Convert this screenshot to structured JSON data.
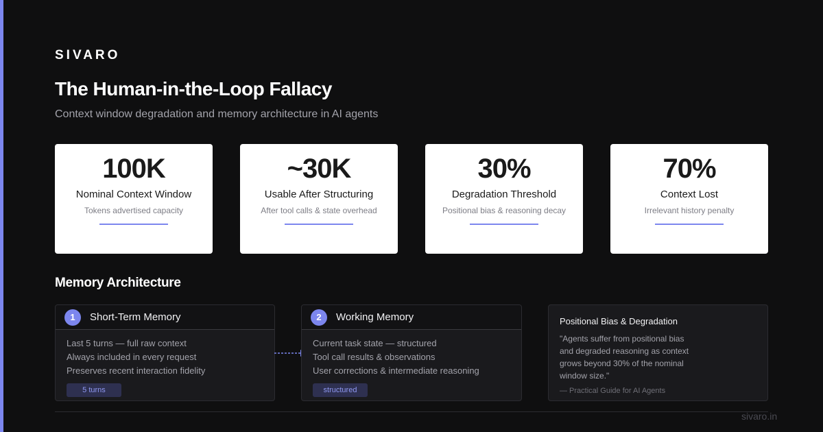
{
  "brand": "SIVARO",
  "title": "The Human-in-the-Loop Fallacy",
  "subtitle": "Context window degradation and memory architecture in AI agents",
  "stats": [
    {
      "value": "100K",
      "label": "Nominal Context Window",
      "desc": "Tokens advertised capacity"
    },
    {
      "value": "~30K",
      "label": "Usable After Structuring",
      "desc": "After tool calls & state overhead"
    },
    {
      "value": "30%",
      "label": "Degradation Threshold",
      "desc": "Positional bias & reasoning decay"
    },
    {
      "value": "70%",
      "label": "Context Lost",
      "desc": "Irrelevant history penalty"
    }
  ],
  "section_title": "Memory Architecture",
  "memory": [
    {
      "number": "1",
      "title": "Short-Term Memory",
      "items": [
        "Last 5 turns — full raw context",
        "Always included in every request",
        "Preserves recent interaction fidelity"
      ],
      "badge": "5 turns"
    },
    {
      "number": "2",
      "title": "Working Memory",
      "items": [
        "Current task state — structured",
        "Tool call results & observations",
        "User corrections & intermediate reasoning"
      ],
      "badge": "structured"
    }
  ],
  "quote": {
    "title": "Positional Bias & Degradation",
    "text": "\"Agents suffer from positional bias and degraded reasoning as context grows beyond 30% of the nominal window size.\"",
    "source": "— Practical Guide for AI Agents"
  },
  "footer_url": "sivaro.in",
  "colors": {
    "accent": "#7c86ee",
    "background": "#0f0f10",
    "card": "#ffffff"
  }
}
